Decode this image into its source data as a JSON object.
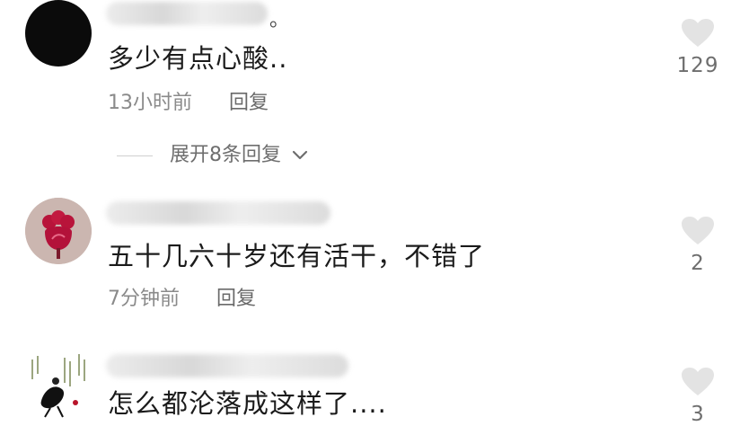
{
  "comments": [
    {
      "text": "多少有点心酸..",
      "time": "13小时前",
      "reply_label": "回复",
      "likes": "129",
      "expand_label": "展开8条回复",
      "username_tail": "。"
    },
    {
      "text": "五十几六十岁还有活干，不错了",
      "time": "7分钟前",
      "reply_label": "回复",
      "likes": "2"
    },
    {
      "text": "怎么都沦落成这样了....",
      "likes": "3"
    }
  ],
  "colors": {
    "heart": "#e3e3e3",
    "text": "#1b1b1b",
    "meta": "#8a8a8a"
  },
  "icons": [
    "heart-icon",
    "chevron-down-icon"
  ]
}
